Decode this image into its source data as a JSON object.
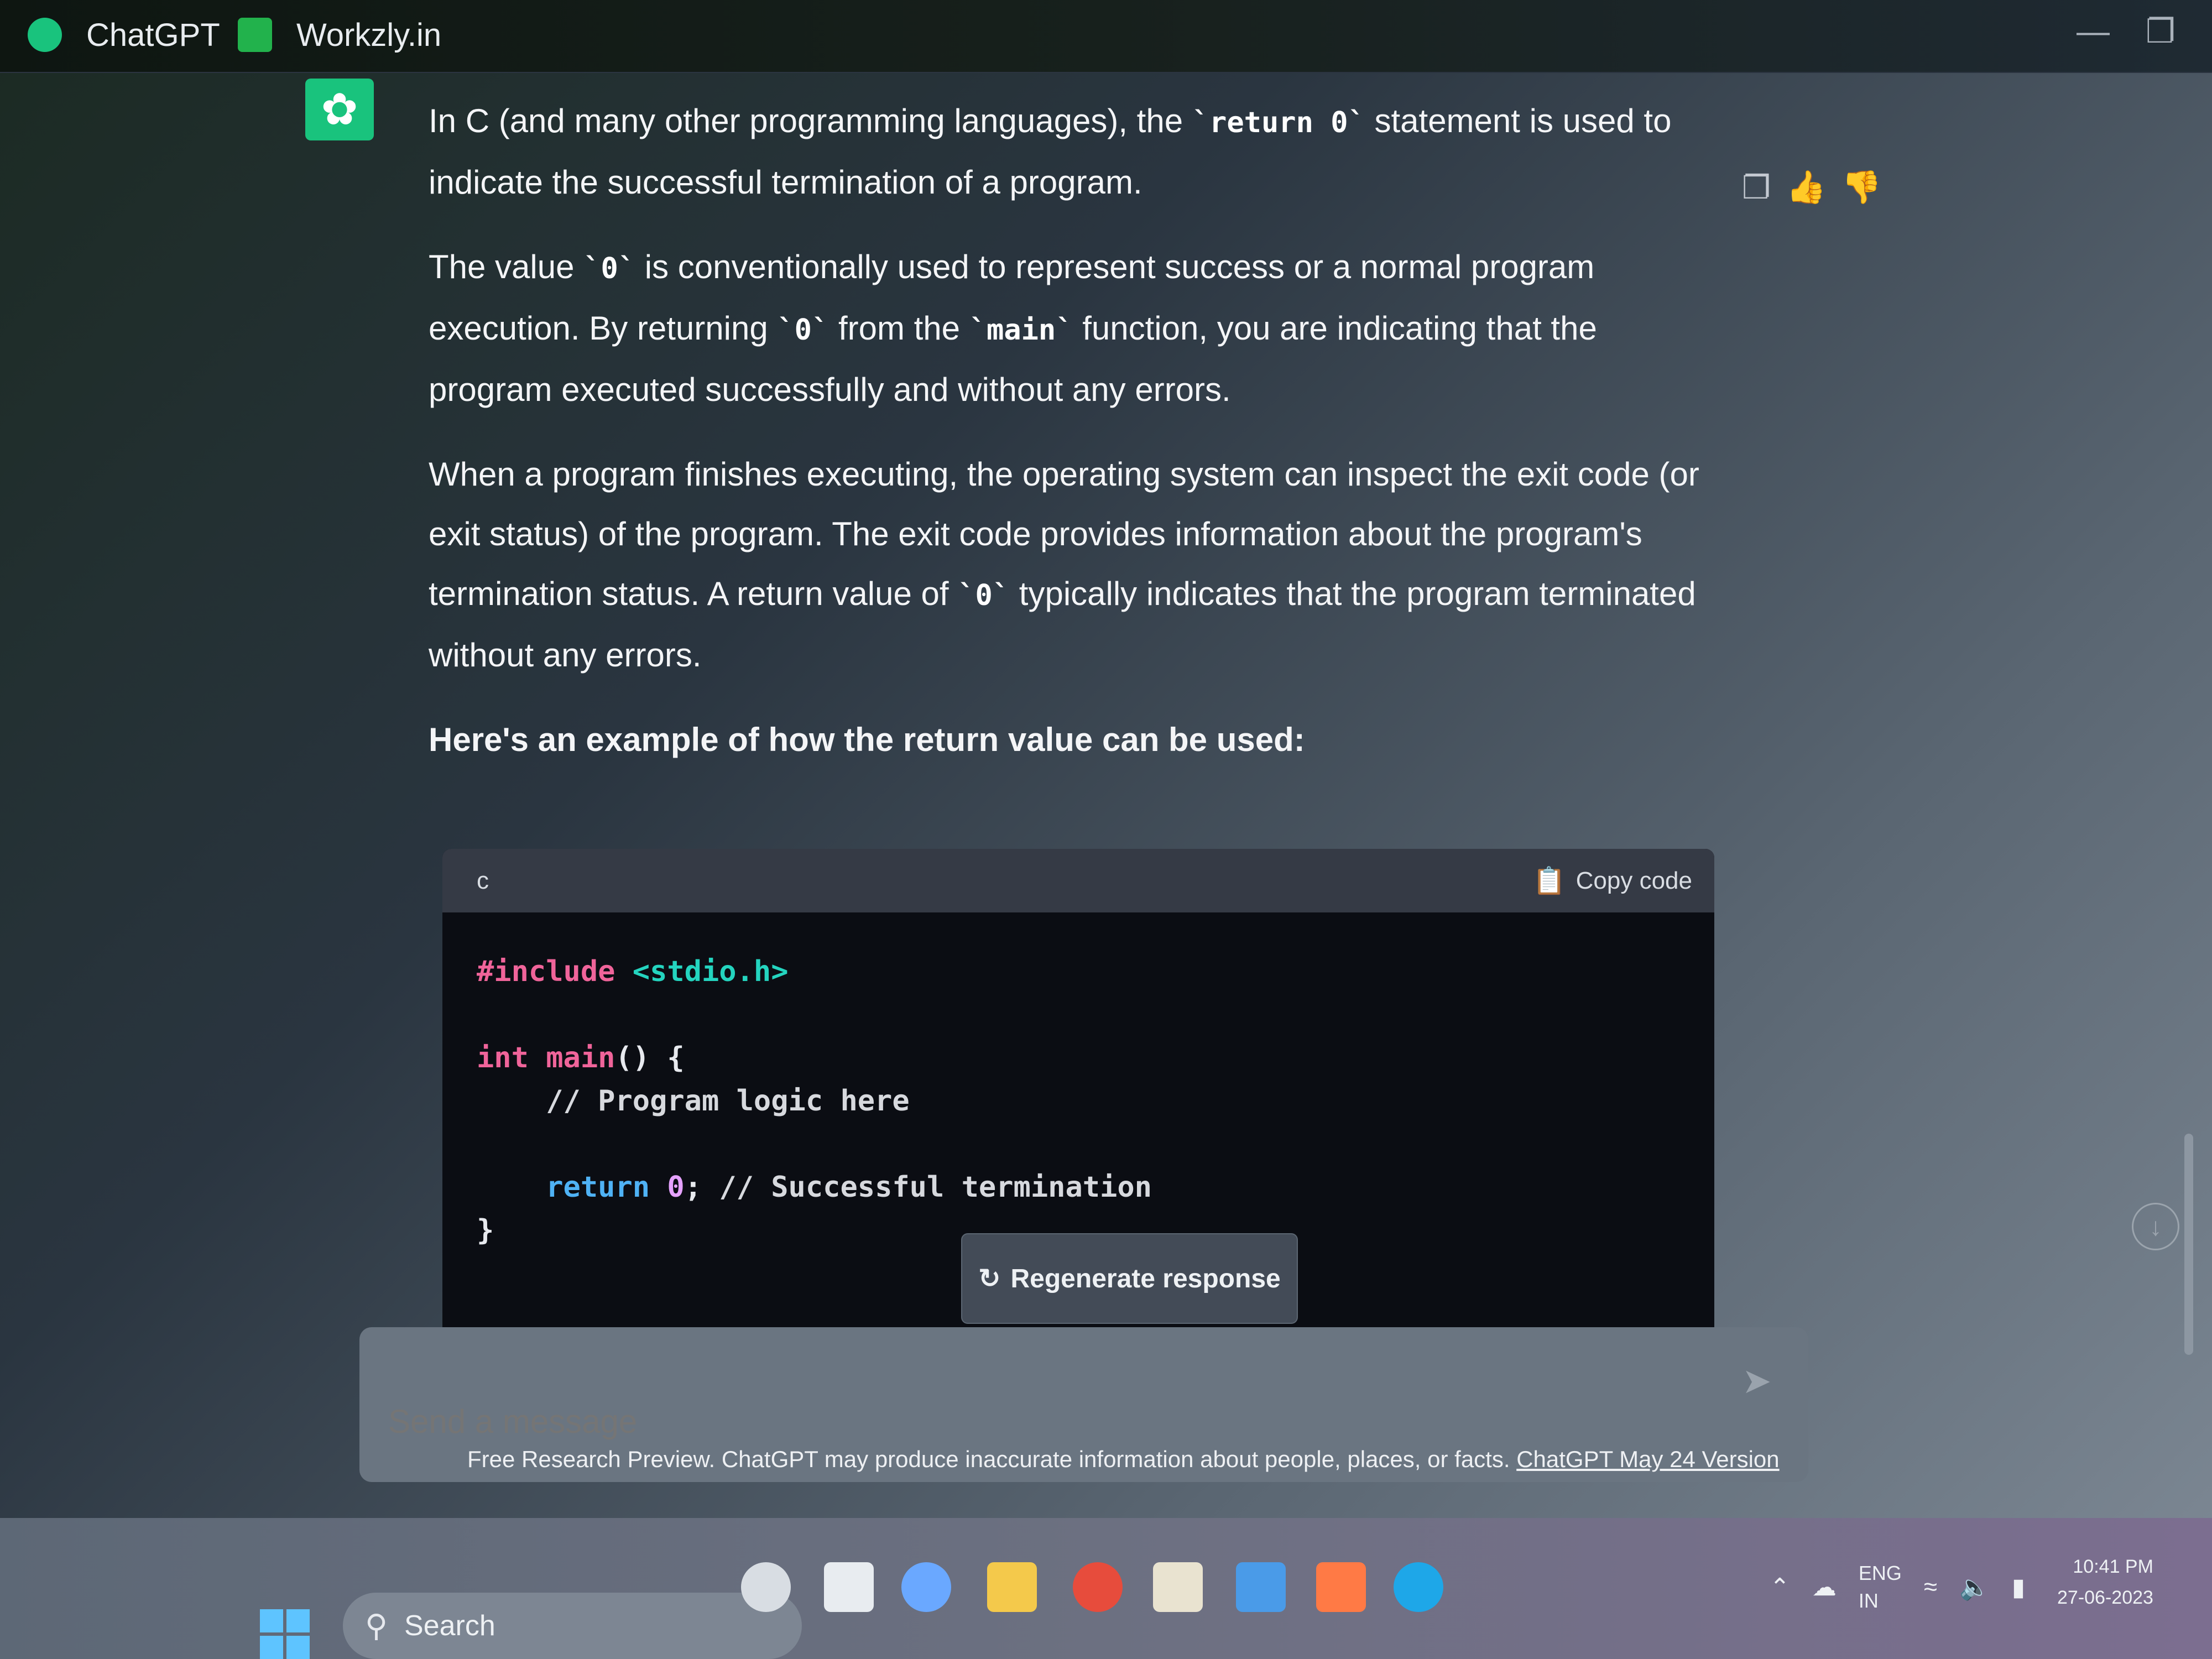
{
  "browser": {
    "tabs": [
      {
        "label": "ChatGPT"
      },
      {
        "label": "Workzly.in"
      }
    ]
  },
  "message": {
    "paragraphs": [
      [
        {
          "t": "In C (and many other programming languages), the "
        },
        {
          "c": "`return 0`"
        },
        {
          "t": " statement is used to indicate the successful termination of a program."
        }
      ],
      [
        {
          "t": "The value "
        },
        {
          "c": "`0`"
        },
        {
          "t": " is conventionally used to represent success or a normal program execution. By returning "
        },
        {
          "c": "`0`"
        },
        {
          "t": " from the "
        },
        {
          "c": "`main`"
        },
        {
          "t": " function, you are indicating that the program executed successfully and without any errors."
        }
      ],
      [
        {
          "t": "When a program finishes executing, the operating system can inspect the exit code (or exit status) of the program. The exit code provides information about the program's termination status. A return value of "
        },
        {
          "c": "`0`"
        },
        {
          "t": " typically indicates that the program terminated without any errors."
        }
      ],
      [
        {
          "t": "Here's an example of how the return value can be used:"
        }
      ]
    ]
  },
  "code_block": {
    "language": "c",
    "copy_label": "Copy code",
    "lines": [
      [
        {
          "s": "kw",
          "t": "#include "
        },
        {
          "s": "str",
          "t": "<stdio.h>"
        }
      ],
      [],
      [
        {
          "s": "kw",
          "t": "int "
        },
        {
          "s": "fn",
          "t": "main"
        },
        {
          "s": "",
          "t": "() {"
        }
      ],
      [
        {
          "s": "cmt",
          "t": "    // Program logic here"
        }
      ],
      [],
      [
        {
          "s": "ret",
          "t": "    return "
        },
        {
          "s": "num",
          "t": "0"
        },
        {
          "s": "",
          "t": "; "
        },
        {
          "s": "cmt",
          "t": "// Successful termination"
        }
      ],
      [
        {
          "s": "",
          "t": "}"
        }
      ]
    ]
  },
  "regenerate_label": "Regenerate response",
  "composer": {
    "placeholder": "Send a message"
  },
  "disclaimer": {
    "text": "Free Research Preview. ChatGPT may produce inaccurate information about people, places, or facts. ",
    "link": "ChatGPT May 24 Version"
  },
  "taskbar": {
    "search_label": "Search",
    "lang": "ENG",
    "region": "IN",
    "time": "10:41 PM",
    "date": "27-06-2023"
  }
}
